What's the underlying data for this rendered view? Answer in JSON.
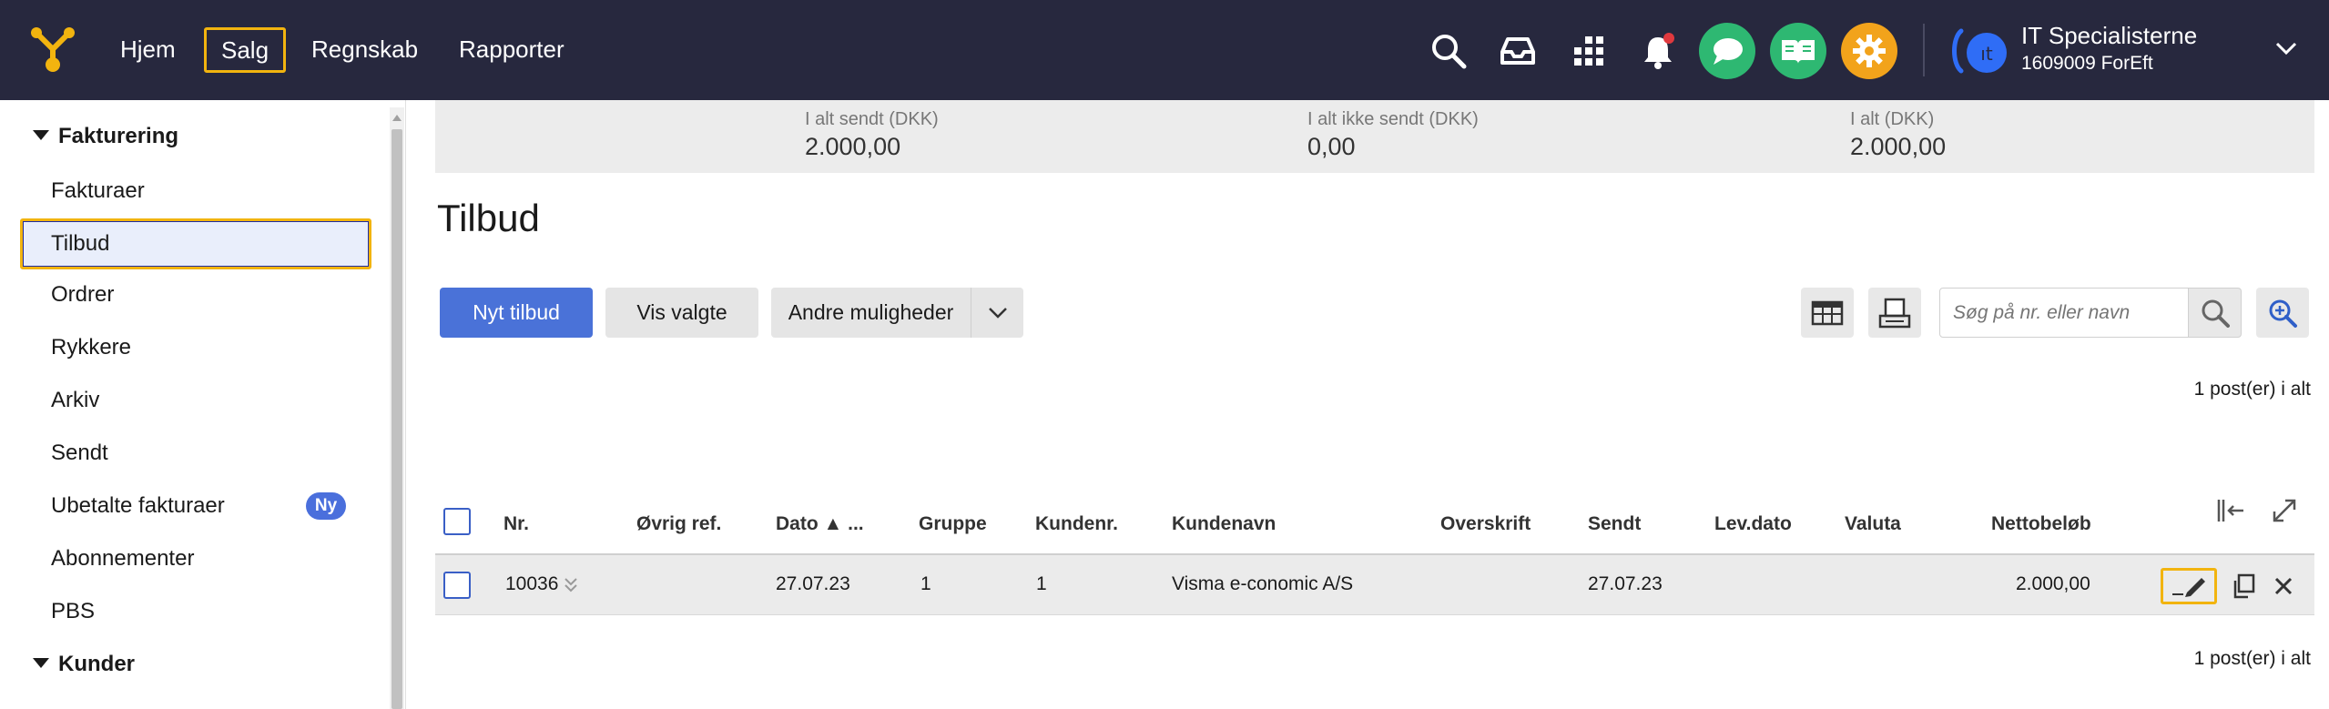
{
  "topnav": {
    "items": [
      {
        "label": "Hjem"
      },
      {
        "label": "Salg",
        "active": true
      },
      {
        "label": "Regnskab"
      },
      {
        "label": "Rapporter"
      }
    ],
    "icons": [
      "search-icon",
      "inbox-icon",
      "apps-grid-icon",
      "bell-icon",
      "chat-icon",
      "book-icon",
      "gear-icon"
    ],
    "company": {
      "name": "IT Specialisterne",
      "id": "1609009 ForEft"
    },
    "colors": {
      "bar": "#27283e",
      "accent": "#f2b40f",
      "chat": "#2eb872",
      "book": "#2eb872",
      "settings": "#f2a31b"
    }
  },
  "sidebar": {
    "groups": [
      {
        "label": "Fakturering",
        "items": [
          {
            "label": "Fakturaer"
          },
          {
            "label": "Tilbud",
            "selected": true
          },
          {
            "label": "Ordrer"
          },
          {
            "label": "Rykkere"
          },
          {
            "label": "Arkiv"
          },
          {
            "label": "Sendt"
          },
          {
            "label": "Ubetalte fakturaer",
            "badge": "Ny"
          },
          {
            "label": "Abonnementer"
          },
          {
            "label": "PBS"
          }
        ]
      },
      {
        "label": "Kunder",
        "items": []
      }
    ]
  },
  "summary": {
    "sent": {
      "label": "I alt sendt (DKK)",
      "value": "2.000,00"
    },
    "not_sent": {
      "label": "I alt ikke sendt (DKK)",
      "value": "0,00"
    },
    "total": {
      "label": "I alt (DKK)",
      "value": "2.000,00"
    }
  },
  "page": {
    "title": "Tilbud",
    "toolbar": {
      "new_label": "Nyt tilbud",
      "show_selected_label": "Vis valgte",
      "more_label": "Andre muligheder",
      "search_placeholder": "Søg på nr. eller navn"
    },
    "count_text": "1 post(er) i alt"
  },
  "table": {
    "columns": [
      "Nr.",
      "Øvrig ref.",
      "Dato ▲ ...",
      "Gruppe",
      "Kundenr.",
      "Kundenavn",
      "Overskrift",
      "Sendt",
      "Lev.dato",
      "Valuta",
      "Nettobeløb"
    ],
    "rows": [
      {
        "nr": "10036",
        "ref": "",
        "dato": "27.07.23",
        "gruppe": "1",
        "kundenr": "1",
        "kundenavn": "Visma e-conomic A/S",
        "overskrift": "",
        "sendt": "27.07.23",
        "levdato": "",
        "valuta": "",
        "netto": "2.000,00"
      }
    ]
  }
}
